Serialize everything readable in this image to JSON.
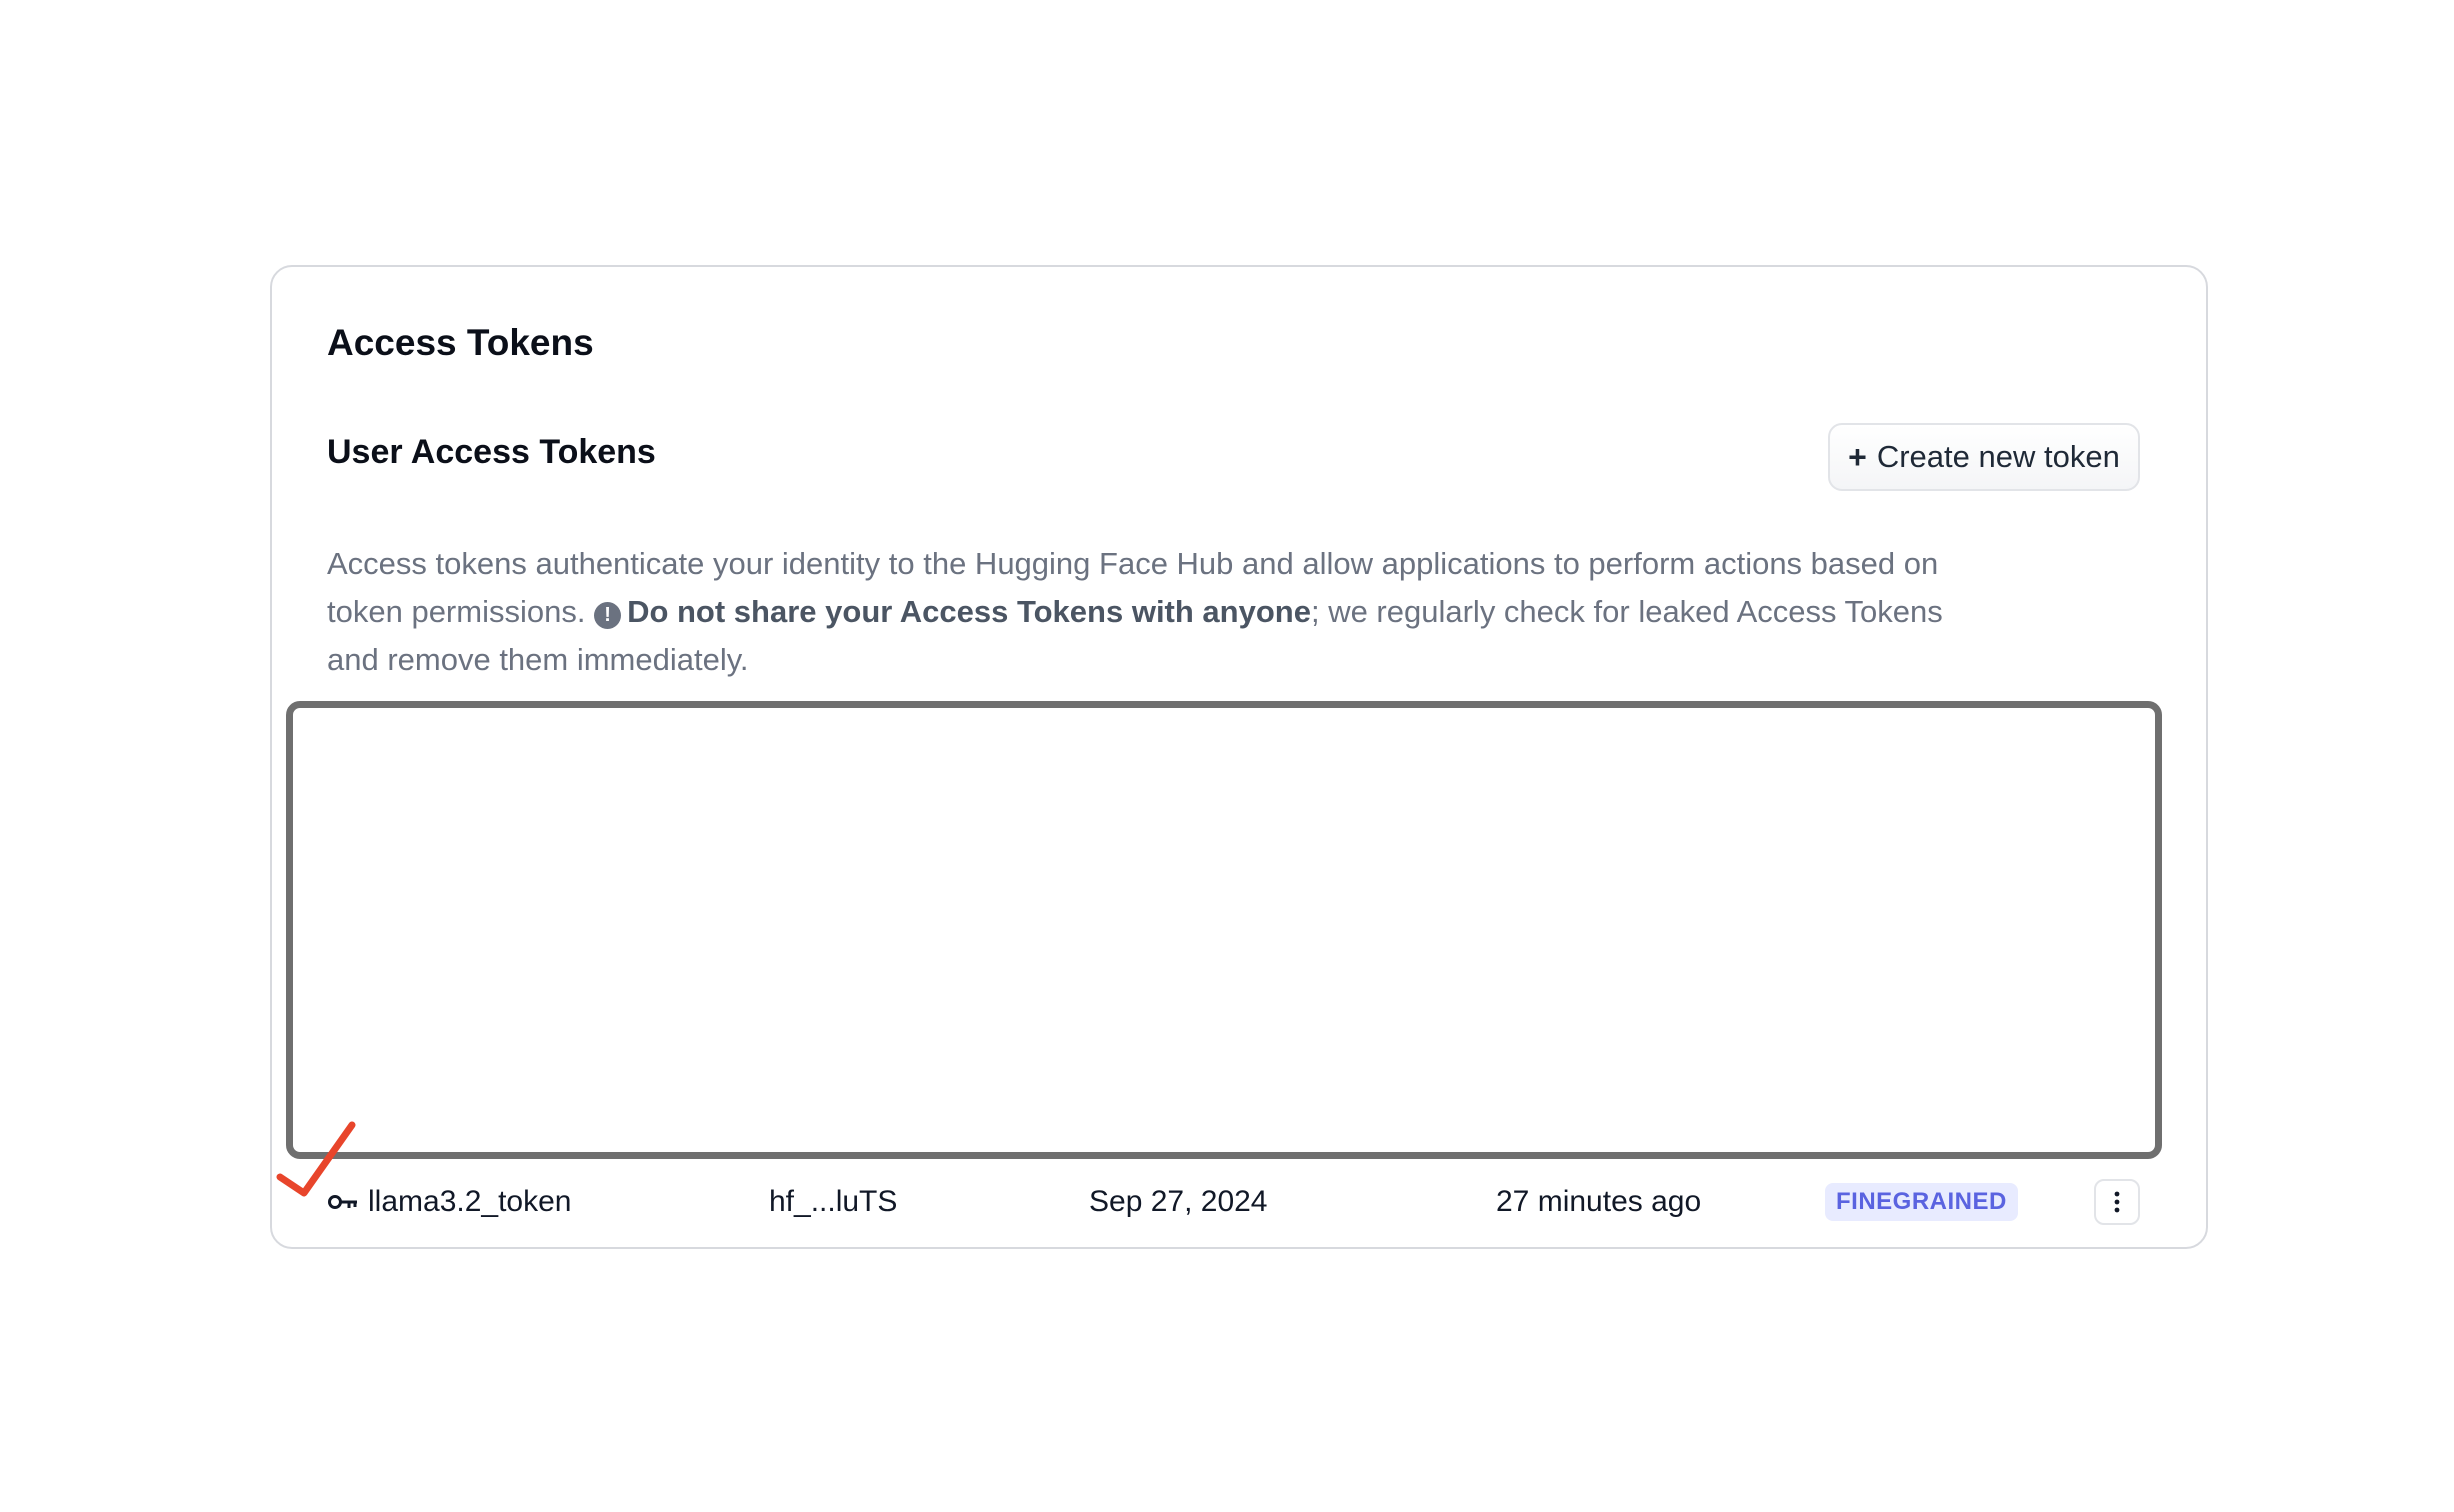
{
  "page": {
    "title": "Access Tokens"
  },
  "section": {
    "title": "User Access Tokens",
    "create_button_label": "Create new token"
  },
  "description": {
    "part1": "Access tokens authenticate your identity to the Hugging Face Hub and allow applications to perform actions based on token permissions. ",
    "warning_icon": "!",
    "bold1": "Do not share your ",
    "bold2": "Access Tokens",
    "bold3": " with anyone",
    "part2": "; we regularly check for leaked Access Tokens and remove them immediately."
  },
  "tokens": [
    {
      "name": "llama3.2_token",
      "value": "hf_...luTS",
      "created": "Sep 27, 2024",
      "last_used": "27 minutes ago",
      "type": "FINEGRAINED"
    }
  ],
  "icons": {
    "key": "key-icon",
    "more": "more-vertical-icon",
    "warning": "exclamation-circle-icon",
    "annotation": "red-checkmark"
  },
  "colors": {
    "badge_bg": "#e8ebff",
    "badge_text": "#5a63e0",
    "annotation": "#e8452b"
  }
}
